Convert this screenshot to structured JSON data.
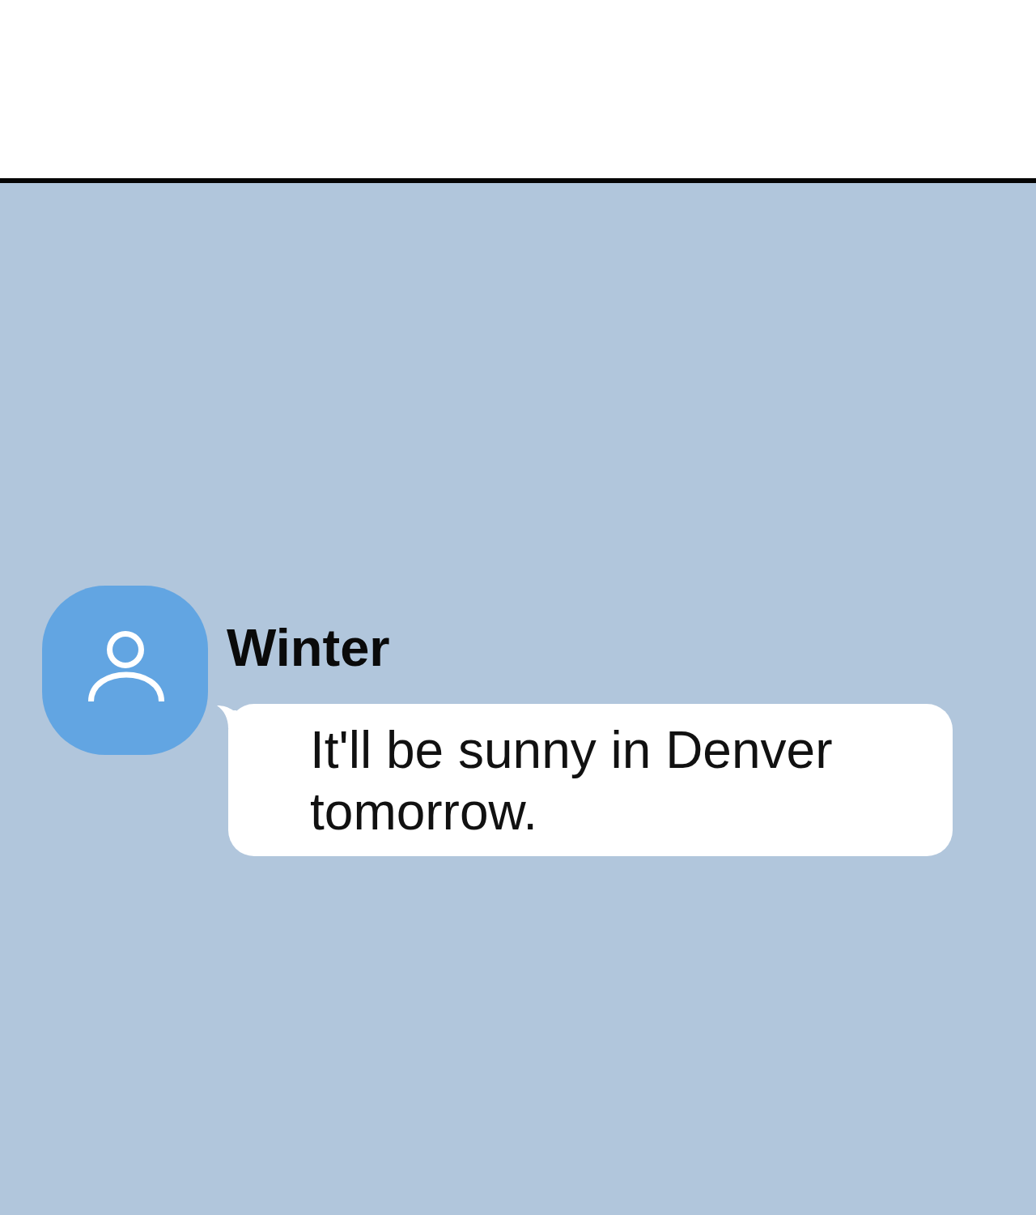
{
  "chat": {
    "messages": [
      {
        "sender": "Winter",
        "text": "It'll be sunny in Denver tomorrow."
      }
    ]
  }
}
